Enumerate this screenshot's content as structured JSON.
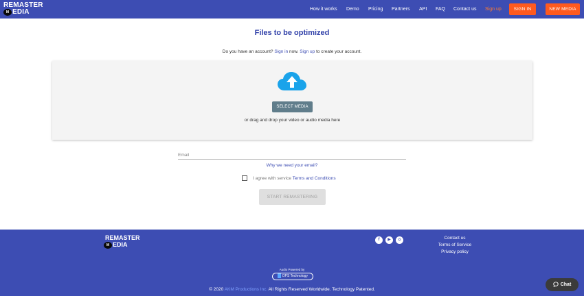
{
  "header": {
    "logo_line1": "REMASTER",
    "logo_line2": "EDIA",
    "logo_badge": "M",
    "nav": [
      {
        "label": "How it works"
      },
      {
        "label": "Demo"
      },
      {
        "label": "Pricing"
      },
      {
        "label": "Partners"
      },
      {
        "label": "API"
      },
      {
        "label": "FAQ"
      },
      {
        "label": "Contact us"
      },
      {
        "label": "Sign up"
      }
    ],
    "signin_button": "SIGN IN",
    "new_media_button": "NEW MEDIA"
  },
  "main": {
    "title": "Files to be optimized",
    "account_prefix": "Do you have an account?",
    "signin_link": "Sign in",
    "account_middle": "now.",
    "signup_link": "Sign up",
    "account_suffix": "to create your account.",
    "select_media_button": "SELECT MEDIA",
    "drag_text": "or drag and drop your video or audio media here",
    "email_placeholder": "Email",
    "why_email_link": "Why we need your email?",
    "agree_text": "I agree with service",
    "terms_link": "Terms and Conditions",
    "start_button": "START REMASTERING"
  },
  "footer": {
    "logo_line1": "REMASTER",
    "logo_line2": "EDIA",
    "logo_badge": "M",
    "links": [
      "Contact us",
      "Terms of Service",
      "Privacy policy"
    ],
    "powered_by": "Audio Powered by",
    "dps_label": "DPS Technology",
    "copyright_prefix": "© 2020",
    "copyright_company": "AKM Productions Inc.",
    "copyright_suffix": "All Rights Reserved Worldwide. Technology Patented."
  },
  "chat": {
    "label": "Chat"
  },
  "colors": {
    "brand_blue": "#3d4db3",
    "accent_orange": "#ff5a1f",
    "cloud_blue": "#1aa3ea",
    "select_button": "#607d8b"
  }
}
